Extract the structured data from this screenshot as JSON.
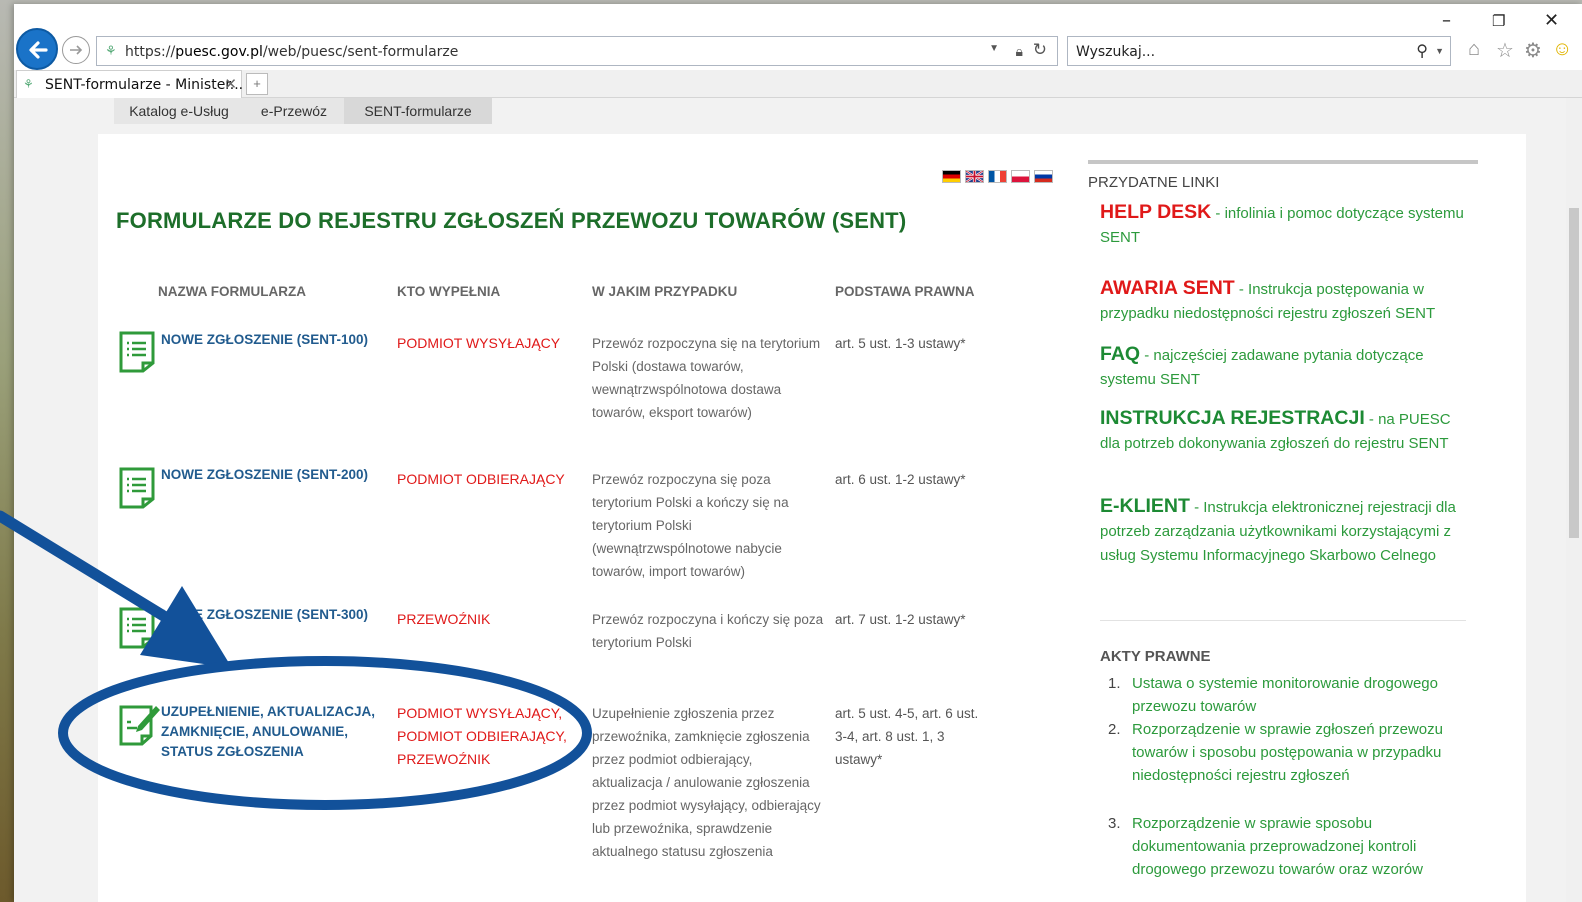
{
  "browser": {
    "window_controls": [
      "–",
      "❐",
      "✕"
    ],
    "address_protocol": "https://",
    "address_host": "puesc.gov.pl",
    "address_path": "/web/puesc/sent-formularze",
    "search_placeholder": "Wyszukaj...",
    "tab_title": "SENT-formularze - Minister...",
    "tab_close": "✕"
  },
  "breadcrumb": [
    "Katalog e-Usług",
    "e-Przewóz",
    "SENT-formularze"
  ],
  "main": {
    "title": "FORMULARZE DO REJESTRU ZGŁOSZEŃ PRZEWOZU TOWARÓW (SENT)",
    "columns": [
      "NAZWA FORMULARZA",
      "KTO WYPEŁNIA",
      "W JAKIM PRZYPADKU",
      "PODSTAWA PRAWNA"
    ],
    "rows": [
      {
        "name": "NOWE ZGŁOSZENIE (SENT-100)",
        "who": "PODMIOT WYSYŁAJĄCY",
        "when": "Przewóz rozpoczyna się na terytorium Polski (dostawa towarów, wewnątrzwspólnotowa dostawa towarów, eksport towarów)",
        "law": "art. 5 ust. 1-3 ustawy*"
      },
      {
        "name": "NOWE ZGŁOSZENIE (SENT-200)",
        "who": "PODMIOT ODBIERAJĄCY",
        "when": "Przewóz rozpoczyna się poza terytorium Polski a kończy się na terytorium Polski (wewnątrzwspólnotowe nabycie towarów, import towarów)",
        "law": "art. 6 ust. 1-2 ustawy*"
      },
      {
        "name": "NOWE ZGŁOSZENIE (SENT-300)",
        "who": "PRZEWOŹNIK",
        "when": "Przewóz rozpoczyna i kończy się poza terytorium Polski",
        "law": "art. 7 ust. 1-2 ustawy*"
      },
      {
        "name": "UZUPEŁNIENIE, AKTUALIZACJA, ZAMKNIĘCIE, ANULOWANIE, STATUS ZGŁOSZENIA",
        "who": "PODMIOT WYSYŁAJĄCY, PODMIOT ODBIERAJĄCY, PRZEWOŹNIK",
        "when": "Uzupełnienie zgłoszenia przez przewoźnika, zamknięcie zgłoszenia przez podmiot odbierający, aktualizacja / anulowanie zgłoszenia przez podmiot wysyłający, odbierający lub przewoźnika, sprawdzenie aktualnego statusu zgłoszenia",
        "law": "art. 5 ust. 4-5, art. 6 ust. 3-4, art. 8 ust. 1, 3 ustawy*"
      }
    ]
  },
  "sidebar": {
    "links_title": "PRZYDATNE LINKI",
    "links": [
      {
        "strong": "HELP DESK",
        "rest": " - infolinia i pomoc dotyczące systemu SENT",
        "color": "#e01919"
      },
      {
        "strong": "AWARIA SENT",
        "rest": " - Instrukcja postępowania w przypadku niedostępności rejestru zgłoszeń SENT",
        "color": "#e01919"
      },
      {
        "strong": "FAQ",
        "rest": " - najczęściej zadawane pytania dotyczące systemu SENT",
        "color": "#1d8a34"
      },
      {
        "strong": "INSTRUKCJA REJESTRACJI",
        "rest": " - na PUESC dla potrzeb dokonywania zgłoszeń do rejestru SENT",
        "color": "#1d8a34"
      },
      {
        "strong": "E-KLIENT",
        "rest": "  - Instrukcja elektronicznej rejestracji dla potrzeb zarządzania użytkownikami korzystającymi z usług Systemu Informacyjnego Skarbowo Celnego",
        "color": "#1d8a34"
      }
    ],
    "acts_title": "AKTY PRAWNE",
    "acts": [
      {
        "num": "1.",
        "text": "Ustawa o systemie monitorowanie drogowego przewozu towarów"
      },
      {
        "num": "2.",
        "text": "Rozporządzenie w sprawie zgłoszeń przewozu towarów i sposobu postępowania w przypadku niedostępności rejestru zgłoszeń"
      },
      {
        "num": "3.",
        "text": "Rozporządzenie w sprawie sposobu dokumentowania przeprowadzonej kontroli drogowego przewozu towarów oraz wzorów"
      }
    ]
  },
  "colors": {
    "title_green": "#1d6e2a",
    "link_green": "#2c9a3c",
    "accent_red": "#e01919",
    "form_blue": "#215b8e",
    "annotation_blue": "#12519a"
  }
}
